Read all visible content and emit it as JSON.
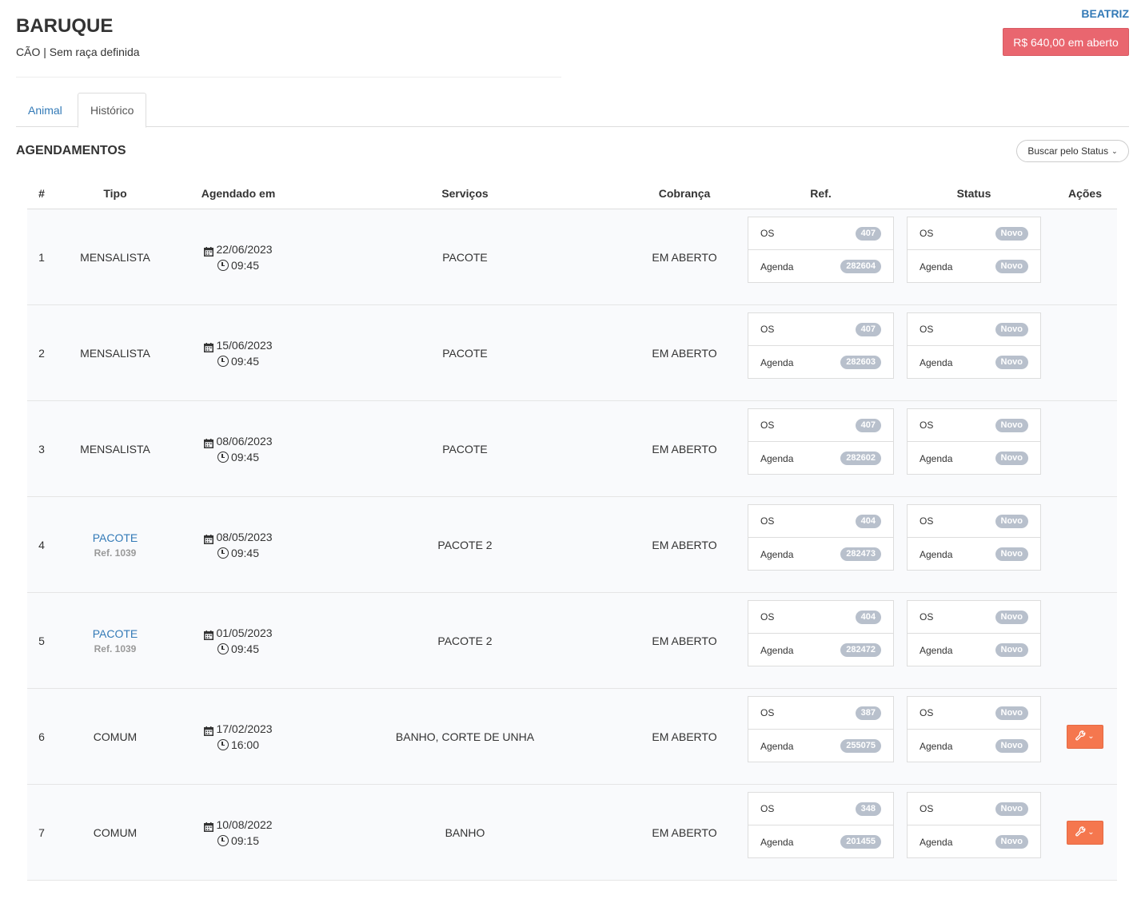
{
  "header": {
    "owner": "BEATRIZ",
    "open_amount": "R$ 640,00 em aberto",
    "pet_name": "BARUQUE",
    "pet_subtitle": "CÃO | Sem raça definida"
  },
  "tabs": [
    {
      "label": "Animal",
      "active": false
    },
    {
      "label": "Histórico",
      "active": true
    }
  ],
  "section": {
    "title": "AGENDAMENTOS",
    "status_filter": "Buscar pelo Status"
  },
  "table": {
    "headers": [
      "#",
      "Tipo",
      "Agendado em",
      "Serviços",
      "Cobrança",
      "Ref.",
      "Status",
      "Ações"
    ],
    "rows": [
      {
        "num": "1",
        "tipo": "MENSALISTA",
        "tipo_link": false,
        "tipo_ref": "",
        "date": "22/06/2023",
        "time": "09:45",
        "servicos": "PACOTE",
        "cobranca": "EM ABERTO",
        "ref_os_label": "OS",
        "ref_os": "407",
        "ref_agenda_label": "Agenda",
        "ref_agenda": "282604",
        "status_os_label": "OS",
        "status_os": "Novo",
        "status_agenda_label": "Agenda",
        "status_agenda": "Novo",
        "has_action": false
      },
      {
        "num": "2",
        "tipo": "MENSALISTA",
        "tipo_link": false,
        "tipo_ref": "",
        "date": "15/06/2023",
        "time": "09:45",
        "servicos": "PACOTE",
        "cobranca": "EM ABERTO",
        "ref_os_label": "OS",
        "ref_os": "407",
        "ref_agenda_label": "Agenda",
        "ref_agenda": "282603",
        "status_os_label": "OS",
        "status_os": "Novo",
        "status_agenda_label": "Agenda",
        "status_agenda": "Novo",
        "has_action": false
      },
      {
        "num": "3",
        "tipo": "MENSALISTA",
        "tipo_link": false,
        "tipo_ref": "",
        "date": "08/06/2023",
        "time": "09:45",
        "servicos": "PACOTE",
        "cobranca": "EM ABERTO",
        "ref_os_label": "OS",
        "ref_os": "407",
        "ref_agenda_label": "Agenda",
        "ref_agenda": "282602",
        "status_os_label": "OS",
        "status_os": "Novo",
        "status_agenda_label": "Agenda",
        "status_agenda": "Novo",
        "has_action": false
      },
      {
        "num": "4",
        "tipo": "PACOTE",
        "tipo_link": true,
        "tipo_ref": "Ref. 1039",
        "date": "08/05/2023",
        "time": "09:45",
        "servicos": "PACOTE 2",
        "cobranca": "EM ABERTO",
        "ref_os_label": "OS",
        "ref_os": "404",
        "ref_agenda_label": "Agenda",
        "ref_agenda": "282473",
        "status_os_label": "OS",
        "status_os": "Novo",
        "status_agenda_label": "Agenda",
        "status_agenda": "Novo",
        "has_action": false
      },
      {
        "num": "5",
        "tipo": "PACOTE",
        "tipo_link": true,
        "tipo_ref": "Ref. 1039",
        "date": "01/05/2023",
        "time": "09:45",
        "servicos": "PACOTE 2",
        "cobranca": "EM ABERTO",
        "ref_os_label": "OS",
        "ref_os": "404",
        "ref_agenda_label": "Agenda",
        "ref_agenda": "282472",
        "status_os_label": "OS",
        "status_os": "Novo",
        "status_agenda_label": "Agenda",
        "status_agenda": "Novo",
        "has_action": false
      },
      {
        "num": "6",
        "tipo": "COMUM",
        "tipo_link": false,
        "tipo_ref": "",
        "date": "17/02/2023",
        "time": "16:00",
        "servicos": "BANHO, CORTE DE UNHA",
        "cobranca": "EM ABERTO",
        "ref_os_label": "OS",
        "ref_os": "387",
        "ref_agenda_label": "Agenda",
        "ref_agenda": "255075",
        "status_os_label": "OS",
        "status_os": "Novo",
        "status_agenda_label": "Agenda",
        "status_agenda": "Novo",
        "has_action": true
      },
      {
        "num": "7",
        "tipo": "COMUM",
        "tipo_link": false,
        "tipo_ref": "",
        "date": "10/08/2022",
        "time": "09:15",
        "servicos": "BANHO",
        "cobranca": "EM ABERTO",
        "ref_os_label": "OS",
        "ref_os": "348",
        "ref_agenda_label": "Agenda",
        "ref_agenda": "201455",
        "status_os_label": "OS",
        "status_os": "Novo",
        "status_agenda_label": "Agenda",
        "status_agenda": "Novo",
        "has_action": true
      }
    ]
  },
  "colors": {
    "link": "#337ab7",
    "open_amount_bg": "#e9666f",
    "action_button": "#f5774e",
    "badge_bg": "#b8c0cc",
    "row_bg": "#f9fafc"
  },
  "icons": {
    "date": "calendar-icon",
    "time": "clock-icon",
    "action": "wrench-icon",
    "dropdown": "chevron-down-icon"
  }
}
